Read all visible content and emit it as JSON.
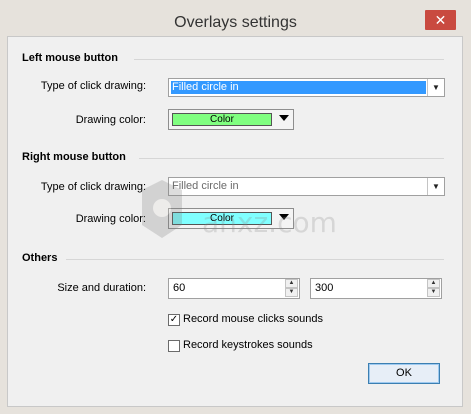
{
  "window": {
    "title": "Overlays settings",
    "close_glyph": "✕"
  },
  "left_mouse": {
    "heading": "Left mouse button",
    "type_label": "Type of click drawing:",
    "type_value": "Filled circle in",
    "color_label": "Drawing color:",
    "color_text": "Color",
    "color_hex": "#80ff80"
  },
  "right_mouse": {
    "heading": "Right mouse button",
    "type_label": "Type of click drawing:",
    "type_value": "Filled circle in",
    "color_label": "Drawing color:",
    "color_text": "Color",
    "color_hex": "#80ffff"
  },
  "others": {
    "heading": "Others",
    "size_label": "Size and duration:",
    "size_value": "60",
    "duration_value": "300",
    "record_clicks_label": "Record mouse clicks sounds",
    "record_clicks_checked": true,
    "record_keys_label": "Record keystrokes sounds",
    "record_keys_checked": false
  },
  "buttons": {
    "ok": "OK"
  },
  "watermark": {
    "text": "anxz.com"
  }
}
